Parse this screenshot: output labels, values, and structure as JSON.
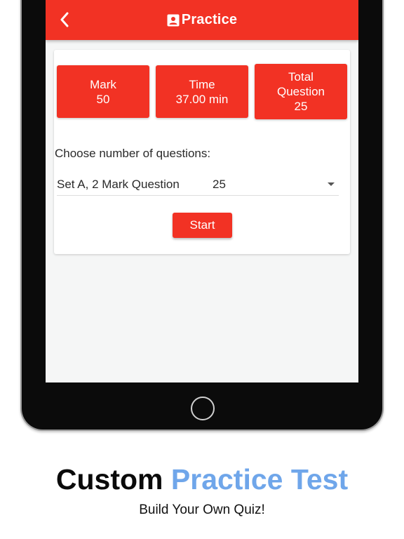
{
  "appbar": {
    "title": "Practice",
    "back_icon": "chevron-left-icon",
    "title_icon": "contact-card-icon",
    "color": "#f23224"
  },
  "stats": {
    "mark": {
      "label": "Mark",
      "value": "50"
    },
    "time": {
      "label": "Time",
      "value": "37.00 min"
    },
    "total": {
      "label_line1": "Total",
      "label_line2": "Question",
      "value": "25"
    }
  },
  "form": {
    "choose_label": "Choose number of questions:",
    "set_label": "Set A, 2 Mark Question",
    "selected_count": "25",
    "start_label": "Start"
  },
  "promo": {
    "headline_part1": "Custom",
    "headline_part2": "Practice Test",
    "subtitle": "Build Your Own Quiz!",
    "accent_color": "#6fa6ea"
  }
}
